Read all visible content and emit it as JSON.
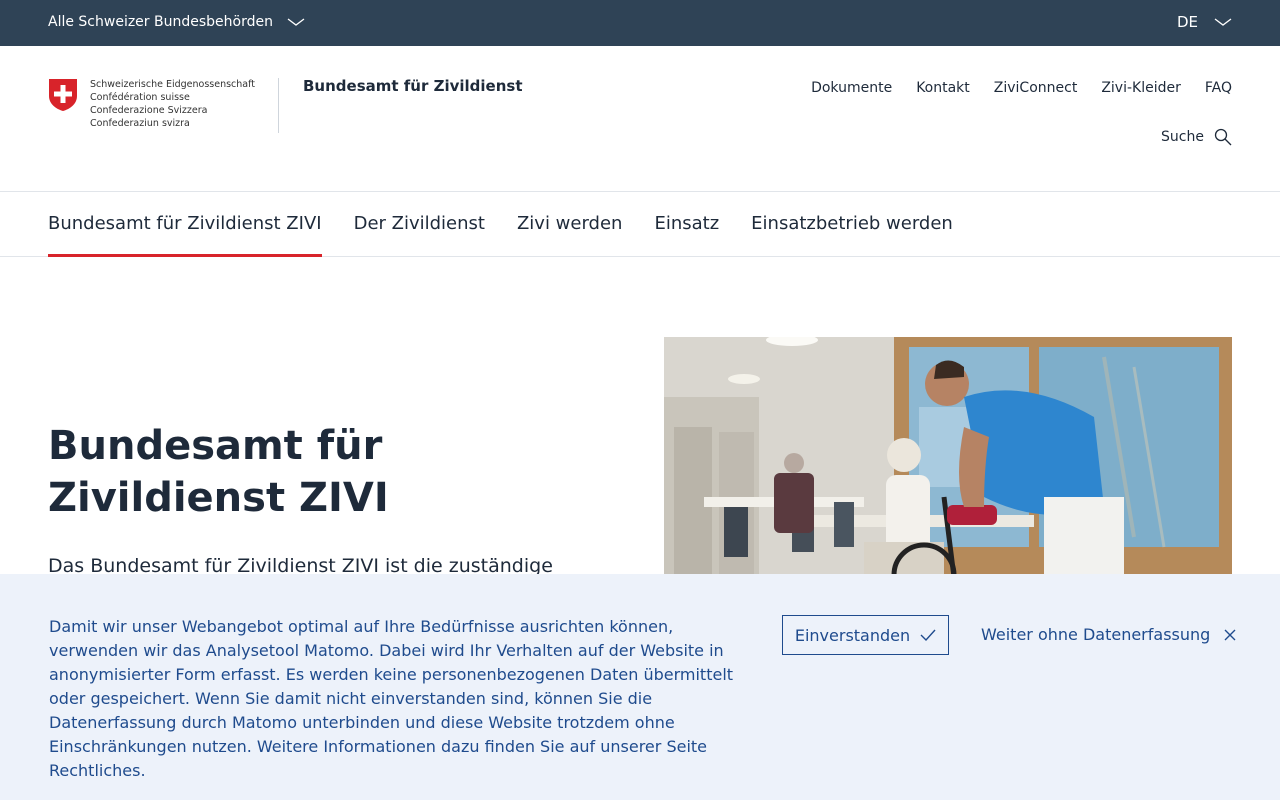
{
  "topbar": {
    "authorities_label": "Alle Schweizer Bundesbehörden",
    "language": "DE"
  },
  "header": {
    "logo_lines": [
      "Schweizerische Eidgenossenschaft",
      "Confédération suisse",
      "Confederazione Svizzera",
      "Confederaziun svizra"
    ],
    "office_name": "Bundesamt für Zivildienst",
    "meta_nav": [
      "Dokumente",
      "Kontakt",
      "ZiviConnect",
      "Zivi-Kleider",
      "FAQ"
    ],
    "search_label": "Suche"
  },
  "main_nav": {
    "items": [
      {
        "label": "Bundesamt für Zivildienst ZIVI",
        "active": true
      },
      {
        "label": "Der Zivildienst"
      },
      {
        "label": "Zivi werden"
      },
      {
        "label": "Einsatz"
      },
      {
        "label": "Einsatzbetrieb werden"
      }
    ]
  },
  "hero": {
    "title": "Bundesamt für Zivildienst ZIVI",
    "intro": "Das Bundesamt für Zivildienst ZIVI ist die zuständige"
  },
  "cookie_banner": {
    "text": "Damit wir unser Webangebot optimal auf Ihre Bedürfnisse ausrichten können, verwenden wir das Analysetool Matomo. Dabei wird Ihr Verhalten auf der Website in anonymisierter Form erfasst. Es werden keine personenbezogenen Daten übermittelt oder gespeichert. Wenn Sie damit nicht einverstanden sind, können Sie die Datenerfassung durch Matomo unterbinden und diese Website trotzdem ohne Einschränkungen nutzen. Weitere Informationen dazu finden Sie auf unserer Seite Rechtliches.",
    "accept_label": "Einverstanden",
    "decline_label": "Weiter ohne Datenerfassung"
  },
  "colors": {
    "topbar": "#2f4356",
    "accent_red": "#d8232a",
    "banner_bg": "#edf2fa",
    "banner_text": "#1f4b8d"
  },
  "icons": [
    "chevron-down-icon",
    "swiss-cross-icon",
    "search-icon",
    "check-icon",
    "close-icon"
  ]
}
